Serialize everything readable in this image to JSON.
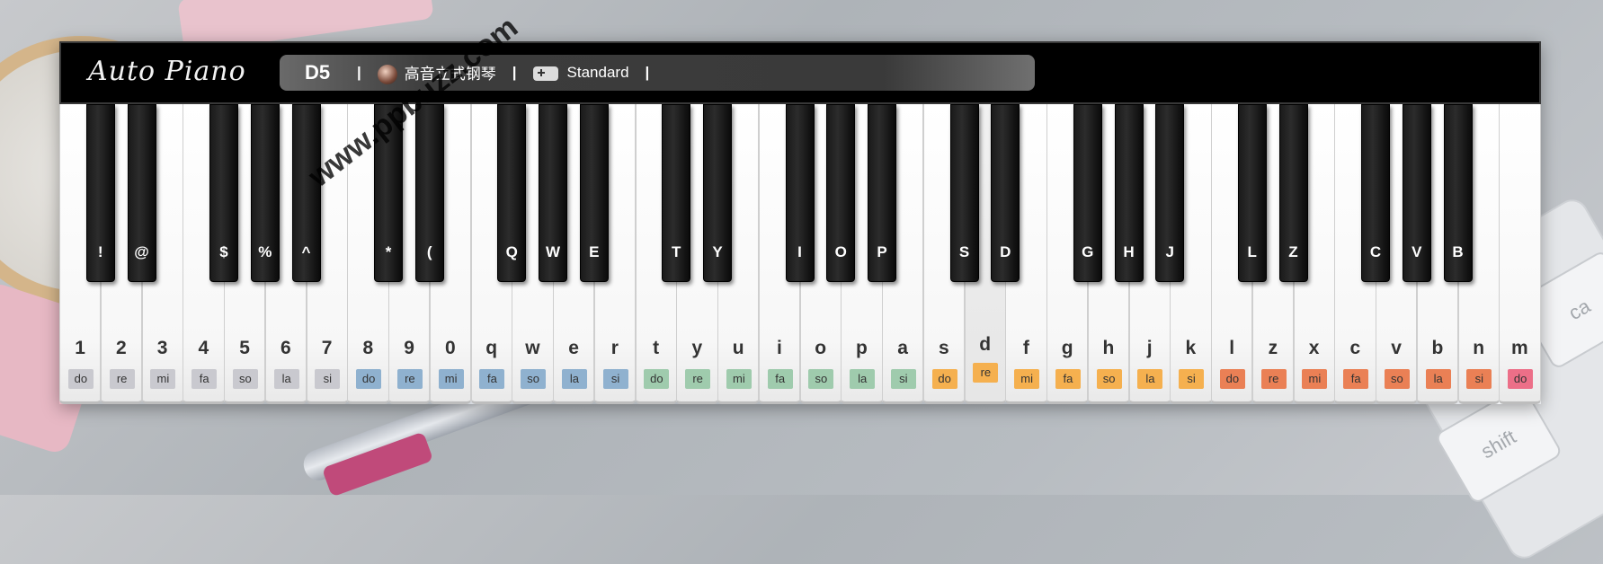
{
  "header": {
    "logo": "Auto Piano",
    "current_note": "D5",
    "separator": "|",
    "instrument_label": "高音立式钢琴",
    "mode_label": "Standard"
  },
  "watermark": "www.ppbuzz.com",
  "solfege_colors": {
    "gray": "#c9c9cf",
    "blue": "#8fb1cf",
    "green": "#9fcbad",
    "orange": "#f5b04f",
    "red": "#ea8055",
    "pink": "#ec6f88"
  },
  "white_keys": [
    {
      "key": "1",
      "solfege": "do",
      "color": "gray"
    },
    {
      "key": "2",
      "solfege": "re",
      "color": "gray"
    },
    {
      "key": "3",
      "solfege": "mi",
      "color": "gray"
    },
    {
      "key": "4",
      "solfege": "fa",
      "color": "gray"
    },
    {
      "key": "5",
      "solfege": "so",
      "color": "gray"
    },
    {
      "key": "6",
      "solfege": "la",
      "color": "gray"
    },
    {
      "key": "7",
      "solfege": "si",
      "color": "gray"
    },
    {
      "key": "8",
      "solfege": "do",
      "color": "blue"
    },
    {
      "key": "9",
      "solfege": "re",
      "color": "blue"
    },
    {
      "key": "0",
      "solfege": "mi",
      "color": "blue"
    },
    {
      "key": "q",
      "solfege": "fa",
      "color": "blue"
    },
    {
      "key": "w",
      "solfege": "so",
      "color": "blue"
    },
    {
      "key": "e",
      "solfege": "la",
      "color": "blue"
    },
    {
      "key": "r",
      "solfege": "si",
      "color": "blue"
    },
    {
      "key": "t",
      "solfege": "do",
      "color": "green"
    },
    {
      "key": "y",
      "solfege": "re",
      "color": "green"
    },
    {
      "key": "u",
      "solfege": "mi",
      "color": "green"
    },
    {
      "key": "i",
      "solfege": "fa",
      "color": "green"
    },
    {
      "key": "o",
      "solfege": "so",
      "color": "green"
    },
    {
      "key": "p",
      "solfege": "la",
      "color": "green"
    },
    {
      "key": "a",
      "solfege": "si",
      "color": "green"
    },
    {
      "key": "s",
      "solfege": "do",
      "color": "orange"
    },
    {
      "key": "d",
      "solfege": "re",
      "color": "orange",
      "pressed": true
    },
    {
      "key": "f",
      "solfege": "mi",
      "color": "orange"
    },
    {
      "key": "g",
      "solfege": "fa",
      "color": "orange"
    },
    {
      "key": "h",
      "solfege": "so",
      "color": "orange"
    },
    {
      "key": "j",
      "solfege": "la",
      "color": "orange"
    },
    {
      "key": "k",
      "solfege": "si",
      "color": "orange"
    },
    {
      "key": "l",
      "solfege": "do",
      "color": "red"
    },
    {
      "key": "z",
      "solfege": "re",
      "color": "red"
    },
    {
      "key": "x",
      "solfege": "mi",
      "color": "red"
    },
    {
      "key": "c",
      "solfege": "fa",
      "color": "red"
    },
    {
      "key": "v",
      "solfege": "so",
      "color": "red"
    },
    {
      "key": "b",
      "solfege": "la",
      "color": "red"
    },
    {
      "key": "n",
      "solfege": "si",
      "color": "red"
    },
    {
      "key": "m",
      "solfege": "do",
      "color": "pink"
    }
  ],
  "black_keys": [
    {
      "key": "!",
      "after": 0
    },
    {
      "key": "@",
      "after": 1
    },
    {
      "key": "$",
      "after": 3
    },
    {
      "key": "%",
      "after": 4
    },
    {
      "key": "^",
      "after": 5
    },
    {
      "key": "*",
      "after": 7
    },
    {
      "key": "(",
      "after": 8
    },
    {
      "key": "Q",
      "after": 10
    },
    {
      "key": "W",
      "after": 11
    },
    {
      "key": "E",
      "after": 12
    },
    {
      "key": "T",
      "after": 14
    },
    {
      "key": "Y",
      "after": 15
    },
    {
      "key": "I",
      "after": 17
    },
    {
      "key": "O",
      "after": 18
    },
    {
      "key": "P",
      "after": 19
    },
    {
      "key": "S",
      "after": 21
    },
    {
      "key": "D",
      "after": 22
    },
    {
      "key": "G",
      "after": 24
    },
    {
      "key": "H",
      "after": 25
    },
    {
      "key": "J",
      "after": 26
    },
    {
      "key": "L",
      "after": 28
    },
    {
      "key": "Z",
      "after": 29
    },
    {
      "key": "C",
      "after": 31
    },
    {
      "key": "V",
      "after": 32
    },
    {
      "key": "B",
      "after": 33
    }
  ],
  "background": {
    "keyboard_keys": [
      "ca",
      "shift"
    ]
  }
}
